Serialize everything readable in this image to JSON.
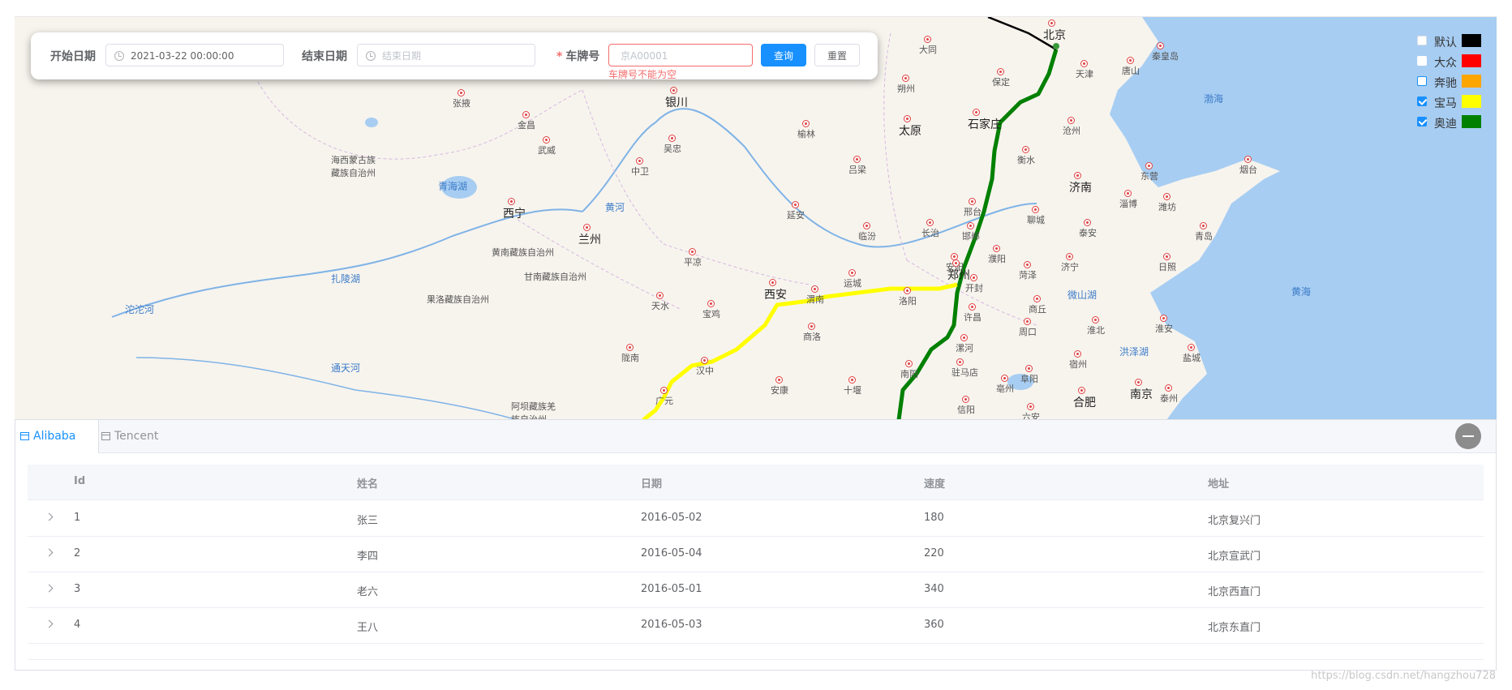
{
  "filter": {
    "start_label": "开始日期",
    "start_value": "2021-03-22 00:00:00",
    "end_label": "结束日期",
    "end_placeholder": "结束日期",
    "plate_required": "*",
    "plate_label": "车牌号",
    "plate_placeholder": "京A00001",
    "plate_error": "车牌号不能为空",
    "query_label": "查询",
    "reset_label": "重置"
  },
  "legend": {
    "items": [
      {
        "label": "默认",
        "color": "#000000",
        "checked": false
      },
      {
        "label": "大众",
        "color": "#ff0000",
        "checked": false
      },
      {
        "label": "奔驰",
        "color": "#ffa500",
        "checked": false
      },
      {
        "label": "宝马",
        "color": "#ffff00",
        "checked": true
      },
      {
        "label": "奥迪",
        "color": "#008000",
        "checked": true
      }
    ]
  },
  "map": {
    "cities": [
      "北京",
      "天津",
      "石家庄",
      "太原",
      "济南",
      "郑州",
      "西安",
      "兰州",
      "西宁",
      "银川",
      "合肥",
      "南京",
      "青岛",
      "武威",
      "张掖",
      "金昌",
      "吴忠",
      "中卫",
      "平凉",
      "天水",
      "宝鸡",
      "延安",
      "榆林",
      "吕梁",
      "临汾",
      "长治",
      "邢台",
      "邯郸",
      "安阳",
      "衡水",
      "沧州",
      "保定",
      "秦皇岛",
      "唐山",
      "大同",
      "朔州",
      "东营",
      "烟台",
      "潍坊",
      "淄博",
      "泰安",
      "聊城",
      "菏泽",
      "济宁",
      "日照",
      "商丘",
      "开封",
      "洛阳",
      "许昌",
      "漯河",
      "周口",
      "驻马店",
      "阜阳",
      "淮北",
      "信阳",
      "南阳",
      "十堰",
      "安康",
      "汉中",
      "商洛",
      "渭南",
      "运城",
      "陇南",
      "广元",
      "淮安",
      "盐城",
      "泰州",
      "六安",
      "宿州",
      "濮阳",
      "亳州"
    ],
    "regions": [
      "海西蒙古族藏族自治州",
      "黄南藏族自治州",
      "甘南藏族自治州",
      "果洛藏族自治州",
      "阿坝藏族羌族自治州"
    ],
    "waters": [
      "青海湖",
      "黄河",
      "扎陵湖",
      "沱沱河",
      "通天河",
      "渤海",
      "黄海",
      "微山湖",
      "洪泽湖"
    ],
    "routes": [
      {
        "name": "奥迪",
        "color": "#008000"
      },
      {
        "name": "宝马",
        "color": "#ffff00"
      },
      {
        "name": "默认",
        "color": "#000000"
      }
    ]
  },
  "tabs": [
    {
      "label": "Alibaba",
      "active": true
    },
    {
      "label": "Tencent",
      "active": false
    }
  ],
  "table": {
    "headers": [
      "Id",
      "姓名",
      "日期",
      "速度",
      "地址"
    ],
    "rows": [
      [
        "1",
        "张三",
        "2016-05-02",
        "180",
        "北京复兴门"
      ],
      [
        "2",
        "李四",
        "2016-05-04",
        "220",
        "北京宣武门"
      ],
      [
        "3",
        "老六",
        "2016-05-01",
        "340",
        "北京西直门"
      ],
      [
        "4",
        "王八",
        "2016-05-03",
        "360",
        "北京东直门"
      ]
    ]
  },
  "watermark": "https://blog.csdn.net/hangzhou728"
}
